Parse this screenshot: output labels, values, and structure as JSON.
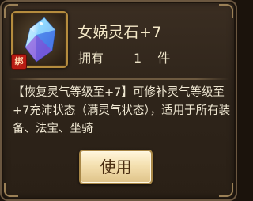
{
  "item": {
    "name": "女娲灵石+7",
    "icon": "crystal-gem-icon",
    "bound_badge": "绑",
    "quantity_label": "拥有",
    "quantity_value": "1",
    "quantity_unit": "件",
    "description": "【恢复灵气等级至+7】可修补灵气等级至+7充沛状态（满灵气状态），适用于所有装备、法宝、坐骑"
  },
  "actions": {
    "use_label": "使用"
  },
  "colors": {
    "panel_bg": "#2e241a",
    "frame_gold": "#b58c3e",
    "badge_red": "#b81c14",
    "button_face": "#f4e0b0",
    "text_light": "#efe7d2"
  }
}
